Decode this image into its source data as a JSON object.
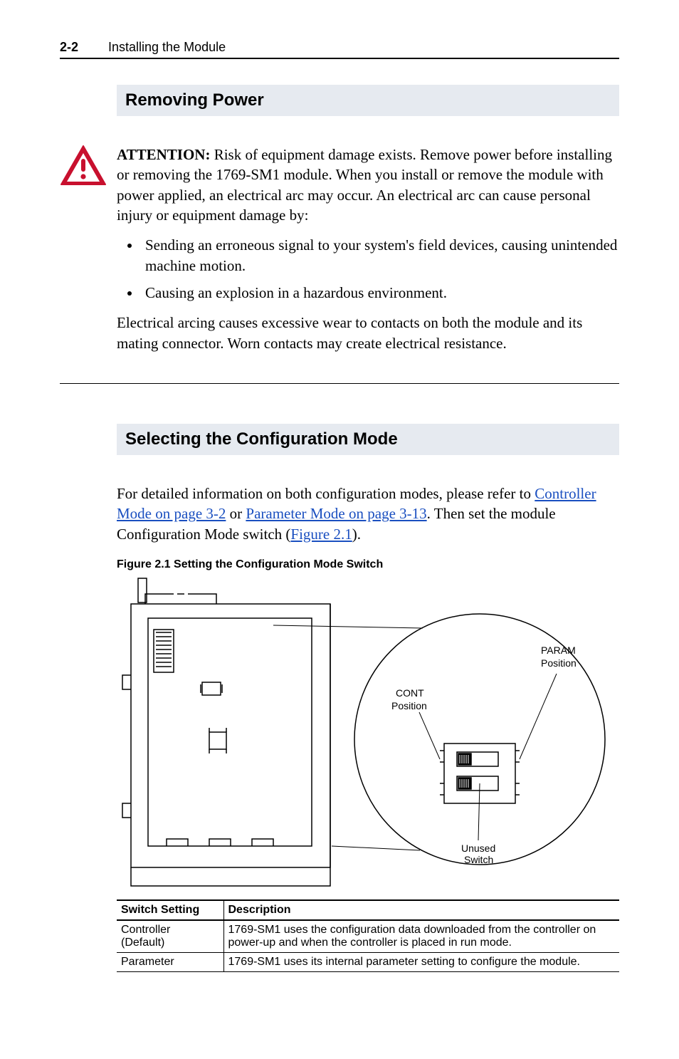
{
  "header": {
    "page_number": "2-2",
    "chapter_title": "Installing the Module"
  },
  "section1": {
    "title": "Removing Power"
  },
  "attention": {
    "label": "ATTENTION:",
    "intro": "Risk of equipment damage exists. Remove power before installing or removing the 1769-SM1 module. When you install or remove the module with power applied, an electrical arc may occur. An electrical arc can cause personal injury or equipment damage by:",
    "bullets": [
      "Sending an erroneous signal to your system's field devices, causing unintended machine motion.",
      "Causing an explosion in a hazardous environment."
    ],
    "outro": "Electrical arcing causes excessive wear to contacts on both the module and its mating connector. Worn contacts may create electrical resistance."
  },
  "section2": {
    "title": "Selecting the Configuration Mode",
    "para_pre": "For detailed information on both configuration modes, please refer to ",
    "link1": "Controller Mode on page 3-2",
    "para_mid1": " or ",
    "link2": "Parameter Mode on page 3-13",
    "para_mid2": ". Then set the module Configuration Mode switch (",
    "link3": "Figure 2.1",
    "para_end": ")."
  },
  "figure": {
    "caption": "Figure 2.1   Setting the Configuration Mode Switch",
    "labels": {
      "param": "PARAM",
      "param_pos": "Position",
      "cont": "CONT",
      "cont_pos": "Position",
      "unused": "Unused",
      "switch": "Switch"
    }
  },
  "table": {
    "headers": {
      "setting": "Switch Setting",
      "desc": "Description"
    },
    "rows": [
      {
        "setting_line1": "Controller",
        "setting_line2": "(Default)",
        "desc": "1769-SM1 uses the configuration data downloaded from the controller on power-up and when the controller is placed in run mode."
      },
      {
        "setting_line1": "Parameter",
        "setting_line2": "",
        "desc": "1769-SM1 uses its internal parameter setting to configure the module."
      }
    ]
  }
}
